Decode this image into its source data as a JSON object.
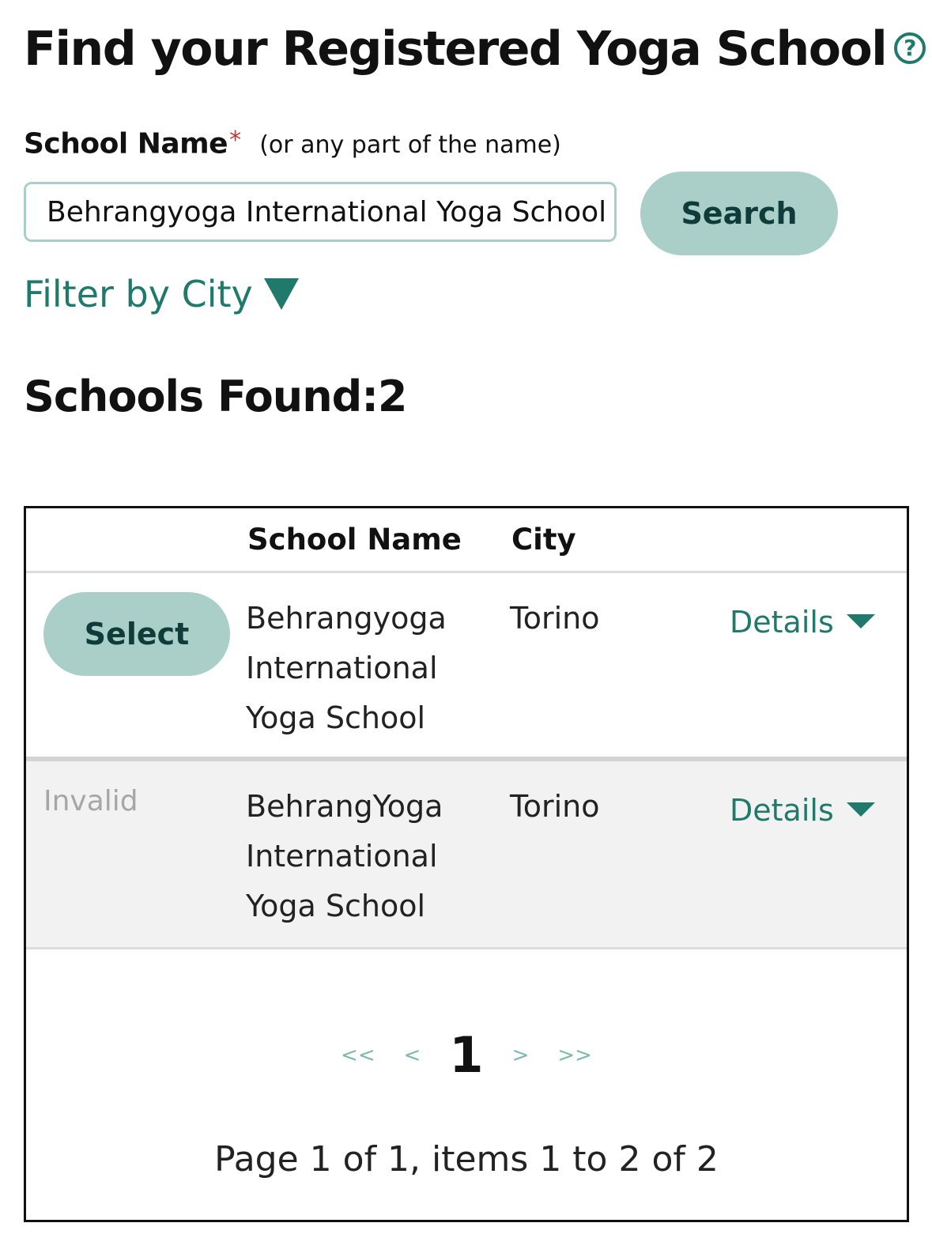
{
  "page": {
    "title": "Find your Registered Yoga School",
    "help_icon": "?"
  },
  "search": {
    "label": "School Name",
    "required_marker": "*",
    "hint": "(or any part of the name)",
    "value": "Behrangyoga International Yoga School",
    "button_label": "Search"
  },
  "filter": {
    "label": "Filter by City",
    "icon": "triangle-down-icon"
  },
  "results": {
    "heading": "Schools Found:2",
    "columns": [
      "",
      "School Name",
      "City",
      ""
    ],
    "rows": [
      {
        "action": "Select",
        "school_name": "Behrangyoga International Yoga School",
        "city": "Torino",
        "details_label": "Details"
      },
      {
        "action": "Invalid",
        "school_name": "BehrangYoga International Yoga School",
        "city": "Torino",
        "details_label": "Details"
      }
    ]
  },
  "pagination": {
    "first": "<<",
    "prev": "<",
    "current": "1",
    "next": ">",
    "last": ">>",
    "summary": "Page 1 of 1, items 1 to 2 of 2"
  },
  "colors": {
    "accent": "#1f7a6c",
    "button_bg": "#a9cfc8",
    "button_text": "#0f3b3a",
    "required": "#c0392b",
    "invalid_text": "#a6a6a6",
    "invalid_row_bg": "#f2f2f2"
  }
}
